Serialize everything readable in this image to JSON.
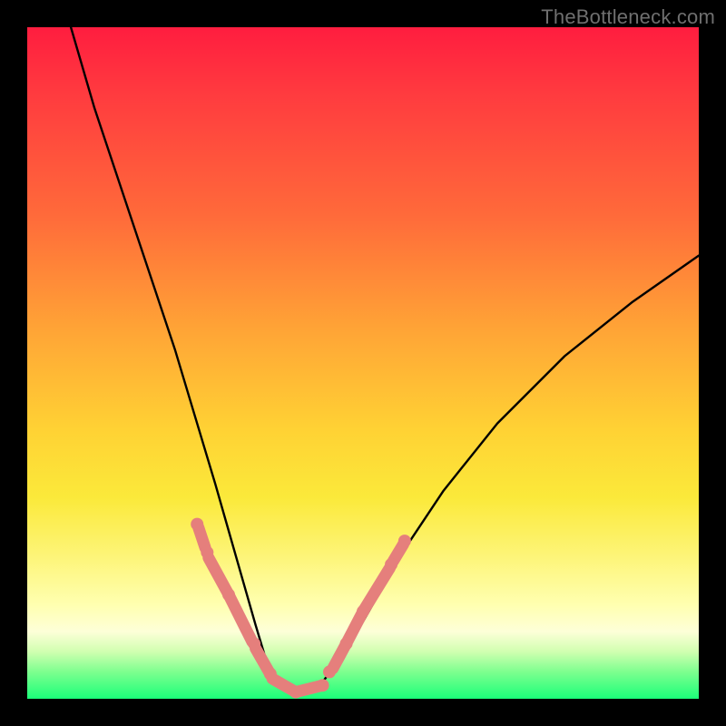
{
  "watermark": "TheBottleneck.com",
  "chart_data": {
    "type": "line",
    "title": "",
    "xlabel": "",
    "ylabel": "",
    "xlim": [
      0,
      1
    ],
    "ylim": [
      0,
      1
    ],
    "series": [
      {
        "name": "curve",
        "x": [
          0.065,
          0.1,
          0.14,
          0.18,
          0.22,
          0.25,
          0.28,
          0.3,
          0.32,
          0.34,
          0.355,
          0.37,
          0.39,
          0.41,
          0.44,
          0.48,
          0.52,
          0.56,
          0.62,
          0.7,
          0.8,
          0.9,
          1.0
        ],
        "y": [
          1.0,
          0.88,
          0.76,
          0.64,
          0.52,
          0.42,
          0.32,
          0.25,
          0.18,
          0.11,
          0.06,
          0.025,
          0.01,
          0.01,
          0.025,
          0.08,
          0.15,
          0.22,
          0.31,
          0.41,
          0.51,
          0.59,
          0.66
        ]
      }
    ],
    "highlight_segments": [
      {
        "x": [
          0.255,
          0.265
        ],
        "y": [
          0.255,
          0.225
        ]
      },
      {
        "x": [
          0.27,
          0.3
        ],
        "y": [
          0.21,
          0.155
        ]
      },
      {
        "x": [
          0.3,
          0.335
        ],
        "y": [
          0.155,
          0.085
        ]
      },
      {
        "x": [
          0.34,
          0.36
        ],
        "y": [
          0.075,
          0.04
        ]
      },
      {
        "x": [
          0.365,
          0.4
        ],
        "y": [
          0.03,
          0.01
        ]
      },
      {
        "x": [
          0.4,
          0.44
        ],
        "y": [
          0.01,
          0.02
        ]
      },
      {
        "x": [
          0.455,
          0.475
        ],
        "y": [
          0.045,
          0.082
        ]
      },
      {
        "x": [
          0.475,
          0.5
        ],
        "y": [
          0.082,
          0.13
        ]
      },
      {
        "x": [
          0.5,
          0.54
        ],
        "y": [
          0.13,
          0.195
        ]
      },
      {
        "x": [
          0.545,
          0.56
        ],
        "y": [
          0.205,
          0.23
        ]
      }
    ],
    "highlight_dots": [
      {
        "x": 0.253,
        "y": 0.26
      },
      {
        "x": 0.268,
        "y": 0.218
      },
      {
        "x": 0.3,
        "y": 0.155
      },
      {
        "x": 0.338,
        "y": 0.082
      },
      {
        "x": 0.362,
        "y": 0.037
      },
      {
        "x": 0.4,
        "y": 0.01
      },
      {
        "x": 0.44,
        "y": 0.02
      },
      {
        "x": 0.45,
        "y": 0.04
      },
      {
        "x": 0.475,
        "y": 0.082
      },
      {
        "x": 0.5,
        "y": 0.13
      },
      {
        "x": 0.542,
        "y": 0.2
      },
      {
        "x": 0.562,
        "y": 0.235
      }
    ]
  }
}
